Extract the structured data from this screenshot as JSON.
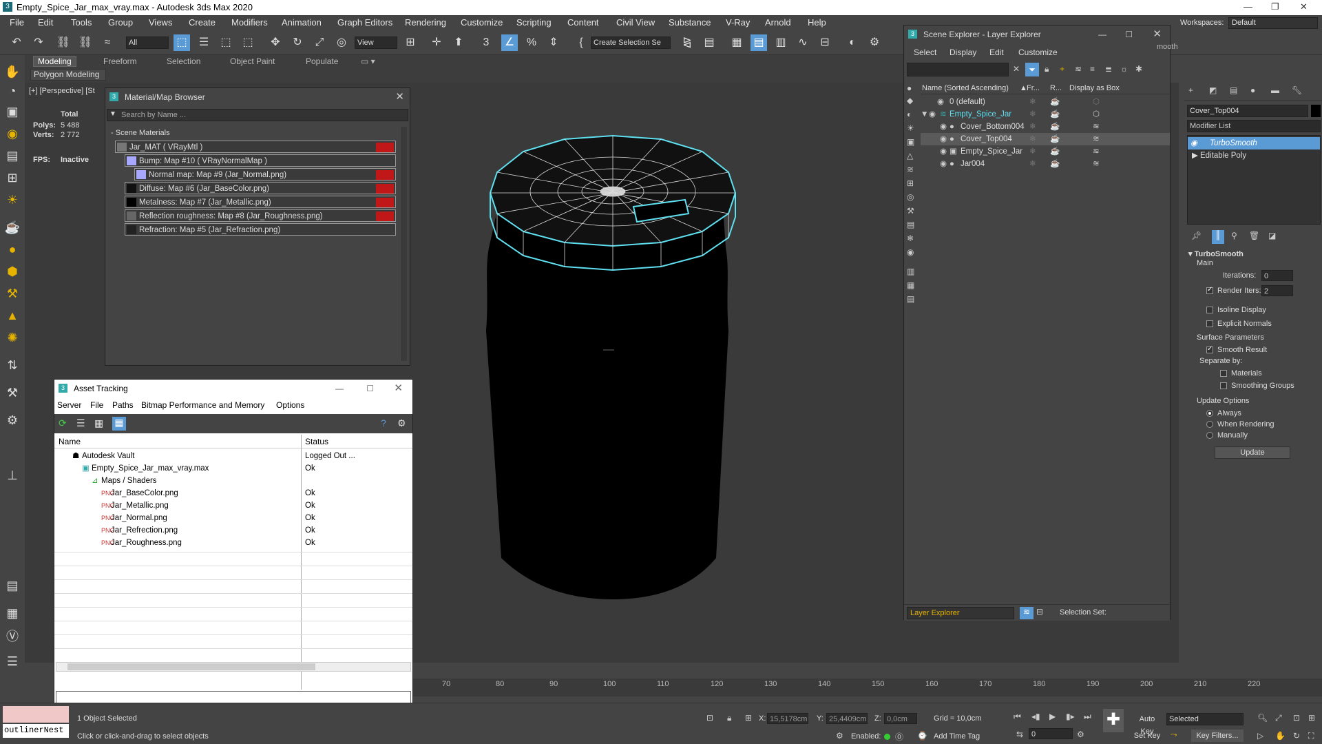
{
  "window": {
    "title": "Empty_Spice_Jar_max_vray.max - Autodesk 3ds Max 2020"
  },
  "menu": [
    "File",
    "Edit",
    "Tools",
    "Group",
    "Views",
    "Create",
    "Modifiers",
    "Animation",
    "Graph Editors",
    "Rendering",
    "Customize",
    "Scripting",
    "Content",
    "Civil View",
    "Substance",
    "V-Ray",
    "Arnold",
    "Help"
  ],
  "workspaces": {
    "label": "Workspaces:",
    "value": "Default"
  },
  "toolbar": {
    "filter": "All",
    "view": "View",
    "selection_set": "Create Selection Se"
  },
  "ribbon": {
    "tabs": [
      "Modeling",
      "Freeform",
      "Selection",
      "Object Paint",
      "Populate"
    ],
    "sub": "Polygon Modeling"
  },
  "viewport": {
    "label": "[+] [Perspective] [St",
    "stats": {
      "total": "Total",
      "polys_label": "Polys:",
      "polys": "5 488",
      "verts_label": "Verts:",
      "verts": "2 772",
      "fps_label": "FPS:",
      "fps": "Inactive"
    }
  },
  "material_browser": {
    "title": "Material/Map Browser",
    "search": "Search by Name ...",
    "group": "Scene Materials",
    "items": [
      "Jar_MAT  ( VRayMtl )",
      "Bump: Map #10  ( VRayNormalMap )",
      "Normal map: Map #9 (Jar_Normal.png)",
      "Diffuse: Map #6 (Jar_BaseColor.png)",
      "Metalness: Map #7 (Jar_Metallic.png)",
      "Reflection roughness: Map #8 (Jar_Roughness.png)",
      "Refraction: Map #5 (Jar_Refraction.png)"
    ]
  },
  "asset_tracking": {
    "title": "Asset Tracking",
    "menu": [
      "Server",
      "File",
      "Paths",
      "Bitmap Performance and Memory",
      "Options"
    ],
    "columns": [
      "Name",
      "Status"
    ],
    "rows": [
      {
        "name": "Autodesk Vault",
        "status": "Logged Out ..."
      },
      {
        "name": "Empty_Spice_Jar_max_vray.max",
        "status": "Ok"
      },
      {
        "name": "Maps / Shaders",
        "status": ""
      },
      {
        "name": "Jar_BaseColor.png",
        "status": "Ok"
      },
      {
        "name": "Jar_Metallic.png",
        "status": "Ok"
      },
      {
        "name": "Jar_Normal.png",
        "status": "Ok"
      },
      {
        "name": "Jar_Refrection.png",
        "status": "Ok"
      },
      {
        "name": "Jar_Roughness.png",
        "status": "Ok"
      }
    ]
  },
  "scene_explorer": {
    "title": "Scene Explorer - Layer Explorer",
    "menu": [
      "Select",
      "Display",
      "Edit",
      "Customize"
    ],
    "columns": [
      "Name (Sorted Ascending)",
      "Fr...",
      "R...",
      "Display as Box"
    ],
    "rows": [
      "0 (default)",
      "Empty_Spice_Jar",
      "Cover_Bottom004",
      "Cover_Top004",
      "Empty_Spice_Jar",
      "Jar004"
    ],
    "footer": "Layer Explorer",
    "selection_set": "Selection Set:"
  },
  "command_panel": {
    "object_name": "Cover_Top004",
    "modifier_list": "Modifier List",
    "stack": [
      "TurboSmooth",
      "Editable Poly"
    ],
    "rollout": "TurboSmooth",
    "main": "Main",
    "iterations_label": "Iterations:",
    "iterations": "0",
    "render_iters_label": "Render Iters:",
    "render_iters": "2",
    "isoline": "Isoline Display",
    "explicit": "Explicit Normals",
    "surface": "Surface Parameters",
    "smooth_result": "Smooth Result",
    "separate_by": "Separate by:",
    "materials": "Materials",
    "smoothing_groups": "Smoothing Groups",
    "update_options": "Update Options",
    "always": "Always",
    "when_rendering": "When Rendering",
    "manually": "Manually",
    "update": "Update",
    "partial": "mooth"
  },
  "timeline": {
    "ticks": [
      "70",
      "80",
      "90",
      "100",
      "110",
      "120",
      "130",
      "140",
      "150",
      "160",
      "170",
      "180",
      "190",
      "200",
      "210",
      "220"
    ]
  },
  "status": {
    "script": "outlinerNest",
    "selected": "1 Object Selected",
    "hint": "Click or click-and-drag to select objects",
    "x_label": "X:",
    "x": "15,5178cm",
    "y_label": "Y:",
    "y": "25,4409cm",
    "z_label": "Z:",
    "z": "0,0cm",
    "grid": "Grid = 10,0cm",
    "enabled": "Enabled:",
    "add_time_tag": "Add Time Tag",
    "auto_key": "Auto Key",
    "set_key": "Set Key",
    "selected_dd": "Selected",
    "key_filters": "Key Filters...",
    "frame": "0"
  }
}
